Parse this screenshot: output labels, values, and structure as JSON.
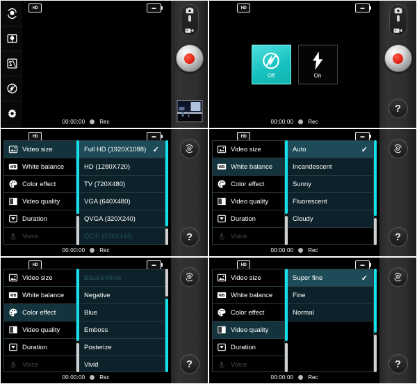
{
  "status": {
    "hd_badge": "HD",
    "battery_badge": "▪",
    "timer": "00:00:00",
    "rec_label": "Rec"
  },
  "toolrail": [
    {
      "name": "camera-switch-icon",
      "label": "Switch camera"
    },
    {
      "name": "white-balance-icon",
      "label": "White balance"
    },
    {
      "name": "exposure-icon",
      "label": "Exposure"
    },
    {
      "name": "flash-off-icon",
      "label": "Flash"
    },
    {
      "name": "settings-gear-icon",
      "label": "Settings"
    }
  ],
  "bezel": {
    "mode_camera": "camera-mode-icon",
    "mode_video": "video-mode-icon",
    "record_button": "record-button",
    "thumbnail": "last-capture-thumbnail",
    "rotate_button": "rotate-camera-button",
    "help_button": "?"
  },
  "flash_panel": {
    "options": [
      {
        "label": "Off",
        "selected": true,
        "icon": "flash-off-icon"
      },
      {
        "label": "On",
        "selected": false,
        "icon": "flash-on-icon"
      }
    ]
  },
  "menu": {
    "items": [
      {
        "label": "Video size",
        "icon": "video-size-icon"
      },
      {
        "label": "White balance",
        "icon": "white-balance-icon"
      },
      {
        "label": "Color effect",
        "icon": "color-effect-icon"
      },
      {
        "label": "Video quality",
        "icon": "video-quality-icon"
      },
      {
        "label": "Duration",
        "icon": "duration-icon"
      },
      {
        "label": "Voice",
        "icon": "voice-icon"
      }
    ]
  },
  "panels": {
    "video_size": {
      "active_menu_index": 0,
      "options": [
        {
          "label": "Full HD (1920X1088)",
          "selected": true
        },
        {
          "label": "HD (1280X720)",
          "selected": false
        },
        {
          "label": "TV (720X480)",
          "selected": false
        },
        {
          "label": "VGA (640X480)",
          "selected": false
        },
        {
          "label": "QVGA (320X240)",
          "selected": false
        },
        {
          "label": "QCIF (176X144)",
          "selected": false
        }
      ]
    },
    "white_balance": {
      "active_menu_index": 1,
      "options": [
        {
          "label": "Auto",
          "selected": true
        },
        {
          "label": "Incandescent",
          "selected": false
        },
        {
          "label": "Sunny",
          "selected": false
        },
        {
          "label": "Fluorescent",
          "selected": false
        },
        {
          "label": "Cloudy",
          "selected": false
        }
      ]
    },
    "color_effect": {
      "active_menu_index": 2,
      "options": [
        {
          "label": "Black&White",
          "selected": false
        },
        {
          "label": "Negative",
          "selected": false
        },
        {
          "label": "Blue",
          "selected": false
        },
        {
          "label": "Emboss",
          "selected": false
        },
        {
          "label": "Posterize",
          "selected": false
        },
        {
          "label": "Vivid",
          "selected": false
        }
      ]
    },
    "video_quality": {
      "active_menu_index": 3,
      "options": [
        {
          "label": "Super fine",
          "selected": true
        },
        {
          "label": "Fine",
          "selected": false
        },
        {
          "label": "Normal",
          "selected": false
        }
      ]
    }
  },
  "colors": {
    "accent_cyan": "#14e0ec",
    "selected_row": "#1d4b57",
    "option_bg": "#0c2129",
    "teal_tile": "#19c3c0"
  }
}
